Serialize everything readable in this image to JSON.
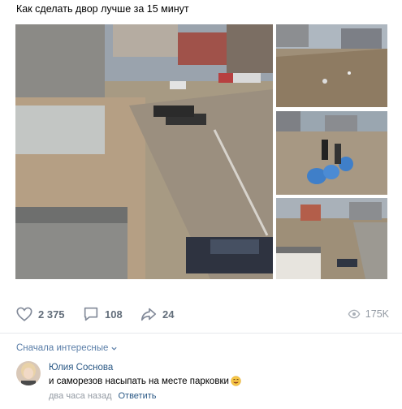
{
  "post": {
    "title": "Как сделать двор лучше за 15 минут"
  },
  "photos": [
    {
      "subject": "yard with parked cars, dirt patch and fence"
    },
    {
      "subject": "trash-covered ground near apartment blocks"
    },
    {
      "subject": "people collecting garbage into blue bags"
    },
    {
      "subject": "cleaned yard viewed from above"
    }
  ],
  "actions": {
    "likes": "2 375",
    "comments": "108",
    "shares": "24",
    "views": "175K"
  },
  "icons": {
    "like": "heart-icon",
    "comment": "comment-icon",
    "share": "share-arrow-icon",
    "views": "eye-icon",
    "sort": "chevron-down-icon"
  },
  "comments_section": {
    "sort_label": "Сначала интересные",
    "items": [
      {
        "author": "Юлия Соснова",
        "text": "и саморезов насыпать на месте парковки",
        "time": "два часа назад",
        "reply_label": "Ответить"
      }
    ]
  },
  "colors": {
    "link": "#2a5885",
    "muted": "#939aa3",
    "action": "#626d7a",
    "sort": "#5a7ea8"
  }
}
